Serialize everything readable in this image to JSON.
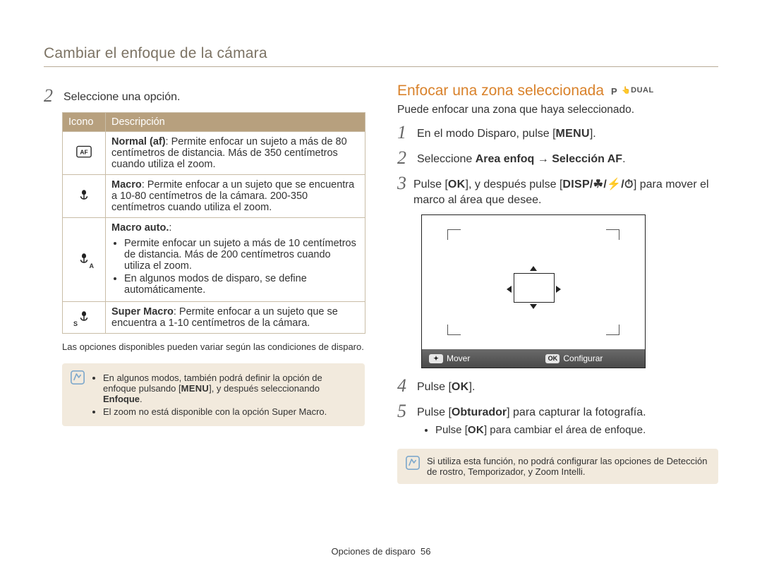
{
  "page_title": "Cambiar el enfoque de la cámara",
  "left": {
    "step2": "Seleccione una opción.",
    "table": {
      "head_icon": "Icono",
      "head_desc": "Descripción",
      "rows": [
        {
          "icon_name": "af-normal-icon",
          "title": "Normal (af)",
          "text": ": Permite enfocar un sujeto a más de 80 centímetros de distancia. Más de 350 centímetros cuando utiliza el zoom."
        },
        {
          "icon_name": "macro-icon",
          "title": "Macro",
          "text": ": Permite enfocar a un sujeto que se encuentra a 10-80 centímetros de la cámara. 200-350 centímetros cuando utiliza el zoom."
        },
        {
          "icon_name": "macro-auto-icon",
          "title": "Macro auto.",
          "title_suffix": ":",
          "bullets": [
            "Permite enfocar un sujeto a más de 10 centímetros de distancia. Más de 200 centímetros cuando utiliza el zoom.",
            "En algunos modos de disparo, se define automáticamente."
          ]
        },
        {
          "icon_name": "super-macro-icon",
          "title": "Super Macro",
          "text": ": Permite enfocar a un sujeto que se encuentra a 1-10 centímetros de la cámara."
        }
      ]
    },
    "footnote": "Las opciones disponibles pueden variar según las condiciones de disparo.",
    "note": {
      "items": [
        {
          "pre": "En algunos modos, también podrá definir la opción de enfoque pulsando [",
          "btn": "MENU",
          "post": "], y después seleccionando ",
          "bold_tail": "Enfoque",
          "tail": "."
        },
        {
          "plain": "El zoom no está disponible con la opción Super Macro."
        }
      ]
    }
  },
  "right": {
    "heading": "Enfocar una zona seleccionada",
    "badges": [
      "P",
      "DUAL"
    ],
    "intro": "Puede enfocar una zona que haya seleccionado.",
    "step1_pre": "En el modo Disparo, pulse [",
    "step1_btn": "MENU",
    "step1_post": "].",
    "step2_pre": "Seleccione ",
    "step2_bold_a": "Area enfoq",
    "step2_arrow": " → ",
    "step2_bold_b": "Selección AF",
    "step2_post": ".",
    "step3_pre": "Pulse [",
    "step3_ok": "OK",
    "step3_mid": "], y después pulse [",
    "step3_icons": "DISP/☘/⚡/⏱",
    "step3_post": "] para mover el marco al área que desee.",
    "lcd": {
      "move": "Mover",
      "set": "Configurar",
      "pill_move": "✦",
      "pill_set": "OK"
    },
    "step4_pre": "Pulse [",
    "step4_ok": "OK",
    "step4_post": "].",
    "step5_pre": "Pulse [",
    "step5_bold": "Obturador",
    "step5_post": "] para capturar la fotografía.",
    "step5_bullet_pre": "Pulse [",
    "step5_bullet_ok": "OK",
    "step5_bullet_post": "] para cambiar el área de enfoque.",
    "note": "Si utiliza esta función, no podrá configurar las opciones de Detección de rostro, Temporizador, y Zoom Intelli."
  },
  "footer": {
    "section": "Opciones de disparo",
    "page": "56"
  }
}
